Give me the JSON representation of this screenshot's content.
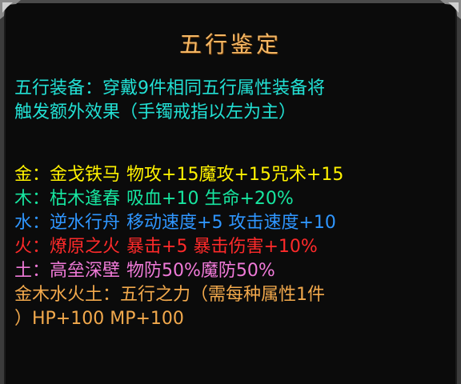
{
  "title": "五行鉴定",
  "intro": {
    "line1": "五行装备：穿戴9件相同五行属性装备将",
    "line2": "触发额外效果（手镯戒指以左为主）"
  },
  "effects": {
    "gold": {
      "element": "金：",
      "name": "金戈铁马",
      "bonus": "物攻+15魔攻+15咒术+15"
    },
    "wood": {
      "element": "木：",
      "name": "枯木逢春",
      "bonus": "吸血+10 生命+20%"
    },
    "water": {
      "element": "水：",
      "name": "逆水行舟",
      "bonus": "移动速度+5 攻击速度+10"
    },
    "fire": {
      "element": "火：",
      "name": "燎原之火",
      "bonus": "暴击+5 暴击伤害+10%"
    },
    "earth": {
      "element": "土：",
      "name": "高垒深壁",
      "bonus": "物防50%魔防50%"
    }
  },
  "all_elements": {
    "line1": "金木水火土：五行之力（需每种属性1件",
    "line2": "）HP+100 MP+100"
  },
  "colors": {
    "title": "#f4b765",
    "intro": "#22e0d4",
    "gold": "#fff200",
    "wood": "#17e6a0",
    "water": "#2f96ff",
    "fire": "#ff2a2a",
    "earth": "#f07ad8",
    "all": "#f2a94c"
  }
}
